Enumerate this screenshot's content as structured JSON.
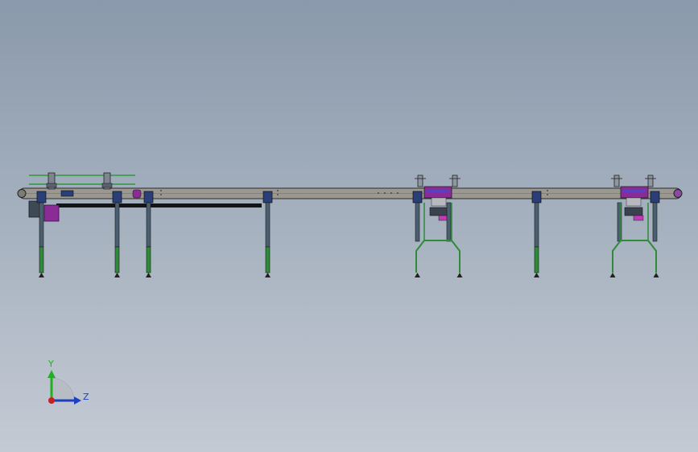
{
  "viewport": {
    "background_top": "#8a99ab",
    "background_bottom": "#c4cad4"
  },
  "model": {
    "frame_color": "#9a9890",
    "frame_edge": "#2c2c2c",
    "leg_upper_color": "#4a6070",
    "leg_lower_color": "#2f8a3a",
    "bracket_color": "#2a3f78",
    "side_rail_color": "#2e9a3a",
    "accent_purple": "#8a2b96",
    "accent_magenta": "#c23ab8",
    "belt_color": "#141414"
  },
  "triad": {
    "y_label": "Y",
    "z_label": "Z",
    "y_color": "#1fb11f",
    "z_color": "#1f3fbf",
    "x_color": "#c82020",
    "icons": [
      "y-arrow-icon",
      "z-arrow-icon",
      "origin-icon"
    ]
  }
}
